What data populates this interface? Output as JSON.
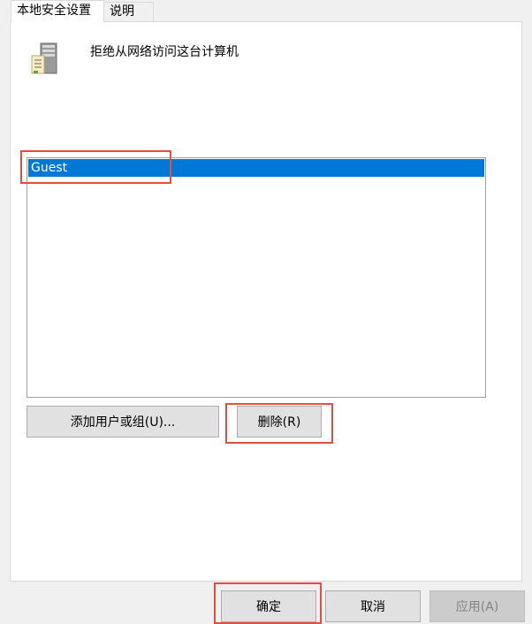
{
  "tabs": [
    {
      "label": "本地安全设置"
    },
    {
      "label": "说明"
    }
  ],
  "policy": {
    "name": "拒绝从网络访问这台计算机",
    "icon": "server-icon"
  },
  "list": {
    "items": [
      {
        "label": "Guest",
        "selected": true
      }
    ]
  },
  "buttons": {
    "add": "添加用户或组(U)...",
    "remove": "删除(R)"
  },
  "footer": {
    "ok": "确定",
    "cancel": "取消",
    "apply": "应用(A)"
  },
  "colors": {
    "selection": "#0078d7",
    "highlight": "#e74c3c"
  }
}
